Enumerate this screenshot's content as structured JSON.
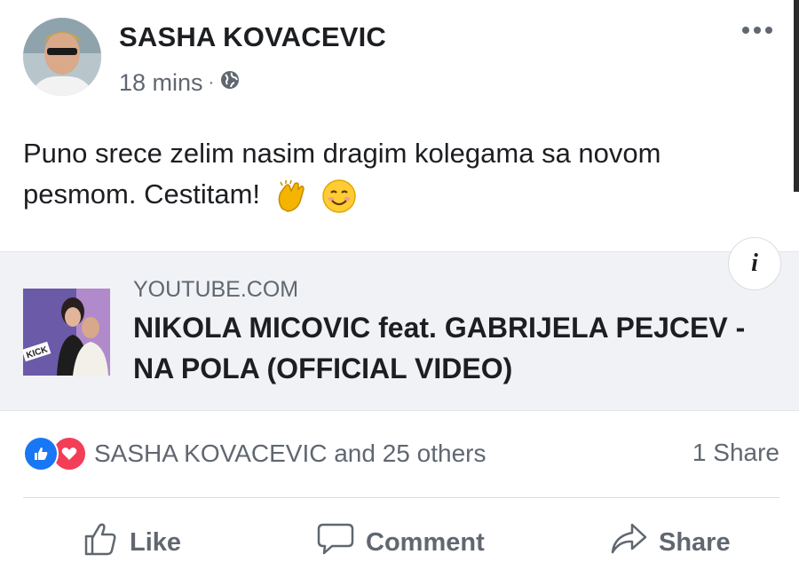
{
  "post": {
    "author": "SASHA KOVACEVIC",
    "time": "18 mins",
    "separator": "·",
    "privacy_icon": "globe-icon",
    "text": "Puno srece zelim nasim dragim kolegama sa novom pesmom. Cestitam!",
    "emojis": [
      "clapping-hands-emoji",
      "smiling-face-emoji"
    ]
  },
  "link": {
    "domain": "YOUTUBE.COM",
    "title": "NIKOLA MICOVIC feat. GABRIJELA PEJCEV - NA POLA (OFFICIAL VIDEO)",
    "info_label": "i"
  },
  "stats": {
    "reactions_text": "SASHA KOVACEVIC and 25 others",
    "shares_text": "1 Share"
  },
  "actions": {
    "like": "Like",
    "comment": "Comment",
    "share": "Share"
  },
  "colors": {
    "like_blue": "#1877f2",
    "love_red": "#f33e58",
    "secondary_text": "#606770"
  }
}
